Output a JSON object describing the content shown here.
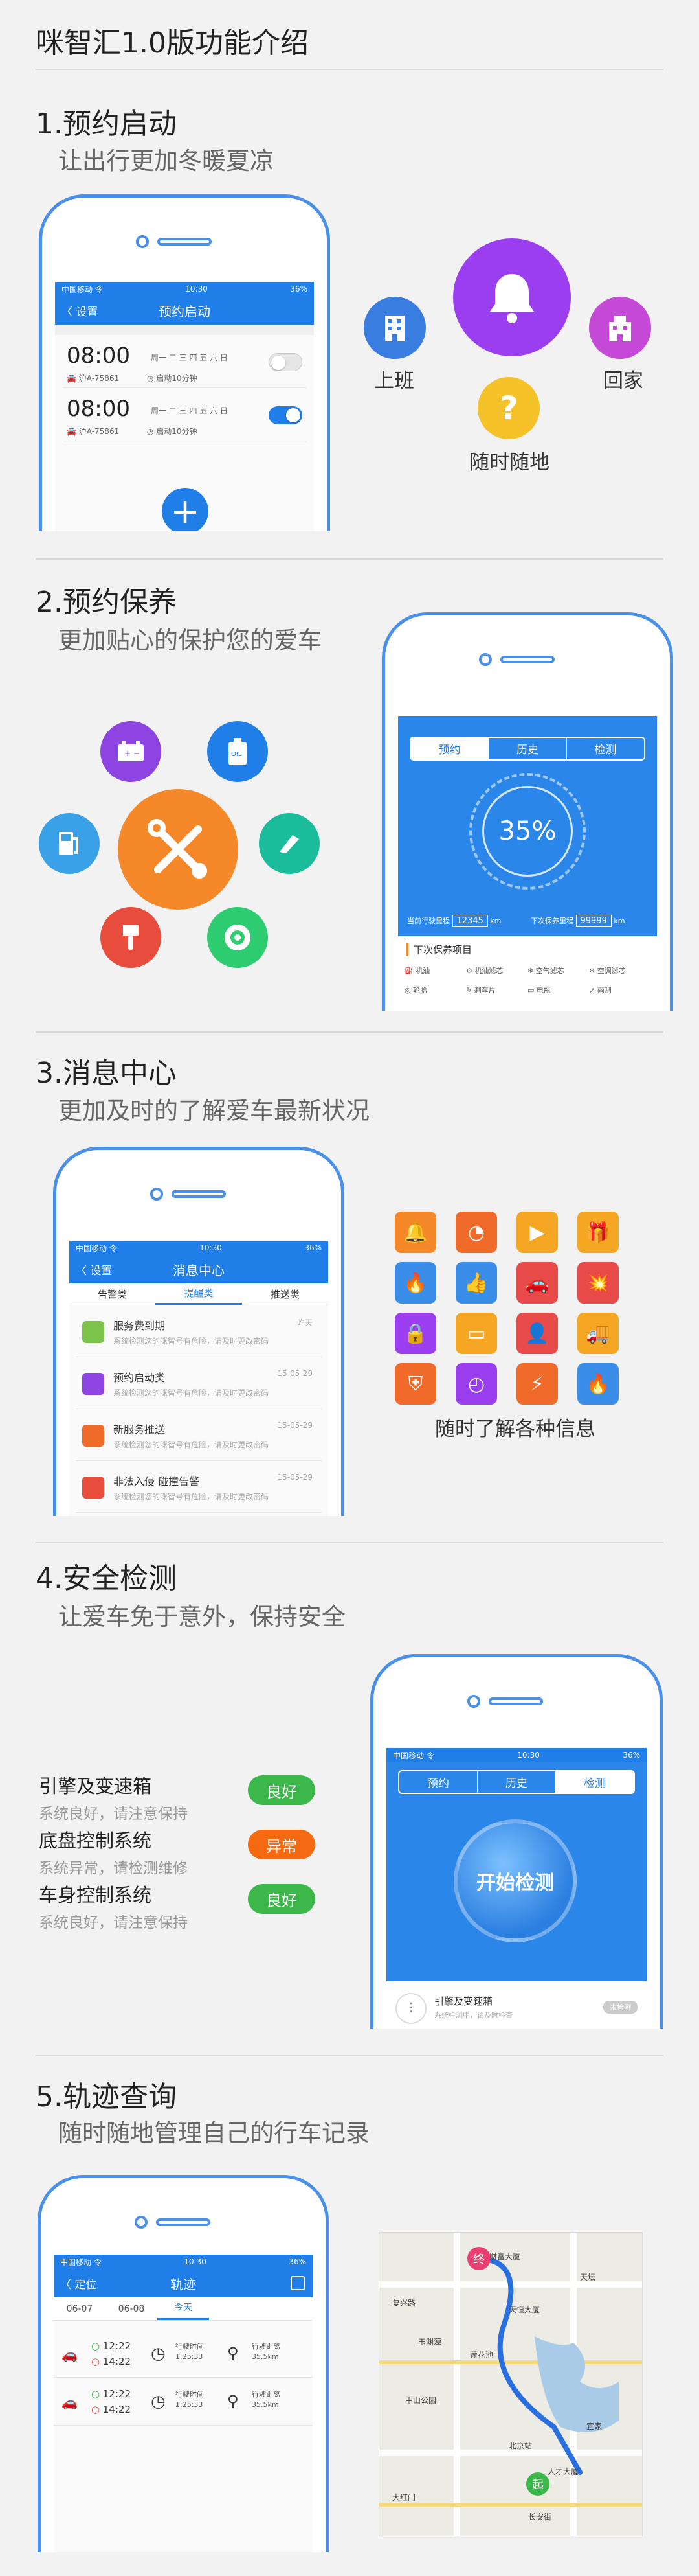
{
  "page_title": "咪智汇1.0版功能介绍",
  "sec1": {
    "heading": "1.预约启动",
    "sub": "让出行更加冬暖夏凉",
    "phone": {
      "status": {
        "carrier": "中国移动 令",
        "time": "10:30",
        "battery": "36%"
      },
      "nav_back": "〈 设置",
      "nav_title": "预约启动",
      "alarms": [
        {
          "time": "08:00",
          "days": "周一 二 三 四 五 六 日",
          "plate": "沪A-75861",
          "note": "启动10分钟",
          "on": false
        },
        {
          "time": "08:00",
          "days": "周一 二 三 四 五 六 日",
          "plate": "沪A-75861",
          "note": "启动10分钟",
          "on": true
        }
      ],
      "add": "+"
    },
    "labels": {
      "work": "上班",
      "home": "回家",
      "any": "随时随地"
    },
    "colors": {
      "bell": "#9b3ef0",
      "work": "#3a7de0",
      "home": "#c54ad8",
      "any": "#f5c22a"
    }
  },
  "sec2": {
    "heading": "2.预约保养",
    "sub": "更加贴心的保护您的爱车",
    "phone": {
      "tabs": [
        "预约",
        "历史",
        "检测"
      ],
      "percent": "35%",
      "mileage_label": "当前行驶里程",
      "mileage": "12345",
      "unit": "km",
      "next_label": "下次保养里程",
      "next": "99999",
      "items_title": "下次保养项目",
      "items": [
        "机油",
        "机油滤芯",
        "空气滤芯",
        "空调滤芯",
        "轮胎",
        "刹车片",
        "电瓶",
        "雨刮"
      ]
    },
    "icon_colors": [
      "#8e44e0",
      "#1f7ee8",
      "#1abc9c",
      "#2ecc71",
      "#e74c3c",
      "#3aa0e8"
    ],
    "center_color": "#f5892a"
  },
  "sec3": {
    "heading": "3.消息中心",
    "sub": "更加及时的了解爱车最新状况",
    "phone": {
      "status": {
        "carrier": "中国移动 令",
        "time": "10:30",
        "battery": "36%"
      },
      "nav_back": "〈 设置",
      "nav_title": "消息中心",
      "tabs": [
        "告警类",
        "提醒类",
        "推送类"
      ],
      "messages": [
        {
          "title": "服务费到期",
          "desc": "系统检测您的咪智号有危险，请及时更改密码",
          "date": "昨天",
          "color": "#7bc34a"
        },
        {
          "title": "预约启动类",
          "desc": "系统检测您的咪智号有危险，请及时更改密码",
          "date": "15-05-29",
          "color": "#8e44e0"
        },
        {
          "title": "新服务推送",
          "desc": "系统检测您的咪智号有危险，请及时更改密码",
          "date": "15-05-29",
          "color": "#f06a2a"
        },
        {
          "title": "非法入侵 碰撞告警",
          "desc": "系统检测您的咪智号有危险，请及时更改密码",
          "date": "15-05-29",
          "color": "#e74c3c"
        }
      ]
    },
    "grid_colors": [
      "#f5892a",
      "#f06a2a",
      "#f5a623",
      "#f5a623",
      "#3a8de8",
      "#3a8de8",
      "#e84a4a",
      "#e84a4a",
      "#9b3ef0",
      "#f5a623",
      "#e84a4a",
      "#f5a623",
      "#f06a2a",
      "#9b3ef0",
      "#f06a2a",
      "#3a8de8"
    ],
    "grid_icons": [
      "bell-icon",
      "speed-icon",
      "video-icon",
      "gift-icon",
      "fire-icon",
      "thumb-icon",
      "car-icon",
      "crash-icon",
      "lock-icon",
      "card-icon",
      "user-icon",
      "tow-icon",
      "shield-icon",
      "clock-icon",
      "plug-icon",
      "flame-icon"
    ],
    "caption": "随时了解各种信息"
  },
  "sec4": {
    "heading": "4.安全检测",
    "sub": "让爱车免于意外，保持安全",
    "systems": [
      {
        "name": "引擎及变速箱",
        "desc": "系统良好，请注意保持",
        "status": "良好",
        "color": "#3cb84a"
      },
      {
        "name": "底盘控制系统",
        "desc": "系统异常，请检测维修",
        "status": "异常",
        "color": "#f56a10"
      },
      {
        "name": "车身控制系统",
        "desc": "系统良好，请注意保持",
        "status": "良好",
        "color": "#3cb84a"
      }
    ],
    "phone": {
      "status": {
        "carrier": "中国移动 令",
        "time": "10:30",
        "battery": "36%"
      },
      "tabs": [
        "预约",
        "历史",
        "检测"
      ],
      "button": "开始检测",
      "row_title": "引擎及变速箱",
      "row_desc": "系统检测中，请及时检查",
      "row_tag": "未检测"
    }
  },
  "sec5": {
    "heading": "5.轨迹查询",
    "sub": "随时随地管理自己的行车记录",
    "phone": {
      "status": {
        "carrier": "中国移动 令",
        "time": "10:30",
        "battery": "36%"
      },
      "nav_back": "〈 定位",
      "nav_title": "轨迹",
      "dates": [
        "06-07",
        "06-08",
        "今天"
      ],
      "trips": [
        {
          "start": "12:22",
          "end": "14:22",
          "dur_label": "行驶时间",
          "dur": "1:25:33",
          "dist_label": "行驶距离",
          "dist": "35.5km"
        },
        {
          "start": "12:22",
          "end": "14:22",
          "dur_label": "行驶时间",
          "dur": "1:25:33",
          "dist_label": "行驶距离",
          "dist": "35.5km"
        }
      ]
    },
    "map": {
      "start": "起",
      "end": "终",
      "labels": [
        "财富大厦",
        "复兴路",
        "天恒大厦",
        "中山公园",
        "莲花池",
        "北京站",
        "大红门",
        "人才大厦",
        "宜家",
        "玉渊潭",
        "长安街",
        "天坛"
      ]
    }
  }
}
